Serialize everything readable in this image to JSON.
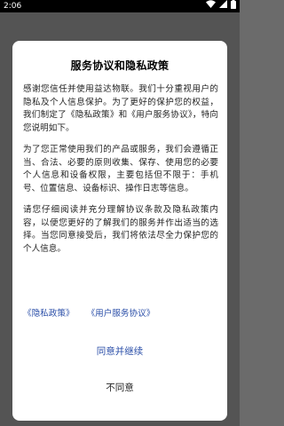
{
  "status_bar": {
    "time": "2:06",
    "icons": [
      "wifi-icon",
      "signal-icon",
      "battery-icon"
    ]
  },
  "dialog": {
    "title": "服务协议和隐私政策",
    "paragraphs": [
      "感谢您信任并使用益达物联。我们十分重视用户的隐私及个人信息保护。为了更好的保护您的权益，我们制定了《隐私政策》和《用户服务协议》，特向您说明如下。",
      "为了您正常使用我们的产品或服务，我们会遵循正当、合法、必要的原则收集、保存、使用您的必要个人信息和设备权限，主要包括但不限于：手机号、位置信息、设备标识、操作日志等信息。",
      "请您仔细阅读并充分理解协议条款及隐私政策内容，以便您更好的了解我们的服务并作出适当的选择。当您同意接受后，我们将依法尽全力保护您的个人信息。"
    ],
    "links": {
      "privacy": "《隐私政策》",
      "user_agreement": "《用户服务协议》"
    },
    "agree_label": "同意并继续",
    "disagree_label": "不同意"
  },
  "colors": {
    "accent": "#2a4ea8",
    "overlay": "#6b6b6b",
    "dialog_bg": "#ffffff"
  }
}
